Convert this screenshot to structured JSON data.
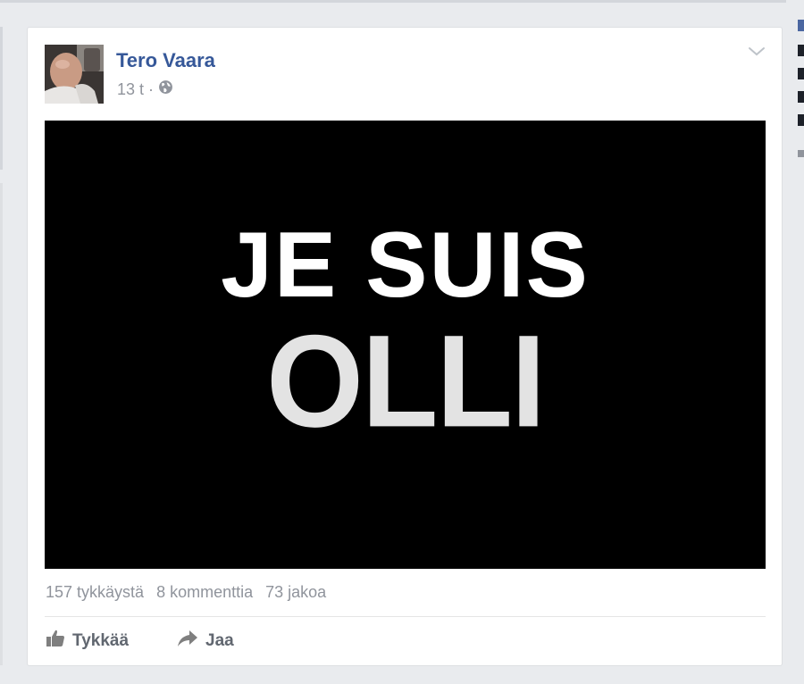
{
  "post": {
    "author": "Tero Vaara",
    "timestamp": "13 t",
    "separator": "·",
    "privacy_icon": "globe-icon",
    "image_text_line1": "JE SUIS",
    "image_text_line2": "OLLI",
    "options_icon": "chevron-down-icon"
  },
  "stats": {
    "likes": "157 tykkäystä",
    "comments": "8 kommenttia",
    "shares": "73 jakoa"
  },
  "actions": {
    "like_label": "Tykkää",
    "like_icon": "thumbs-up-icon",
    "share_label": "Jaa",
    "share_icon": "share-arrow-icon"
  },
  "colors": {
    "link_blue": "#365899",
    "meta_gray": "#90949c",
    "action_gray": "#616770",
    "background": "#e9ebee"
  }
}
